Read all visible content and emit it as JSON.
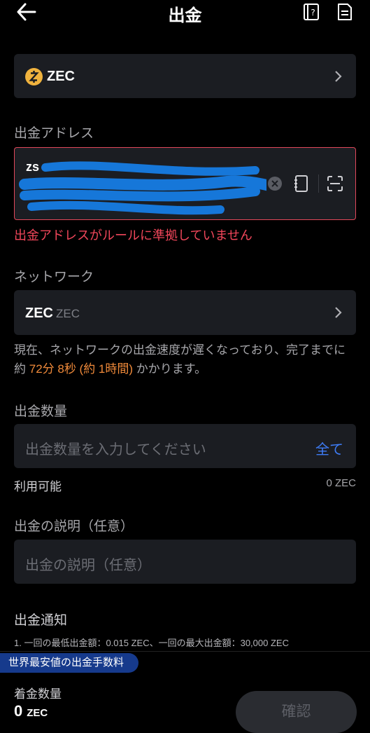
{
  "header": {
    "title": "出金"
  },
  "coin": {
    "symbol": "ZEC",
    "coin_color": "#f0b33e"
  },
  "address": {
    "label": "出金アドレス",
    "value_prefix": "zs",
    "error": "出金アドレスがルールに準拠していません"
  },
  "network": {
    "label": "ネットワーク",
    "name": "ZEC",
    "sub": "ZEC",
    "note_prefix": "現在、ネットワークの出金速度が遅くなっており、完了までに約 ",
    "note_time": "72分  8秒 (約 1時間)",
    "note_suffix": " かかります。"
  },
  "amount": {
    "label": "出金数量",
    "placeholder": "出金数量を入力してください",
    "all_button": "全て",
    "available_label": "利用可能",
    "available_value": "0 ZEC"
  },
  "description": {
    "label": "出金の説明（任意）",
    "placeholder": "出金の説明（任意）"
  },
  "notice": {
    "title": "出金通知",
    "items": [
      "1. 一回の最低出金額：0.015 ZEC、一回の最大出金額：30,000 ZEC"
    ]
  },
  "footer": {
    "badge": "世界最安値の出金手数料",
    "receive_label": "着金数量",
    "receive_value": "0",
    "receive_unit": "ZEC",
    "confirm": "確認"
  },
  "colors": {
    "error": "#f0465a",
    "accent": "#3e7cf5",
    "highlight": "#f08a3a",
    "badge": "#163a8c"
  },
  "icons": [
    "back-arrow-icon",
    "guide-book-icon",
    "history-document-icon",
    "zec-coin-icon",
    "chevron-right-icon",
    "clear-icon",
    "address-book-icon",
    "scan-icon"
  ]
}
